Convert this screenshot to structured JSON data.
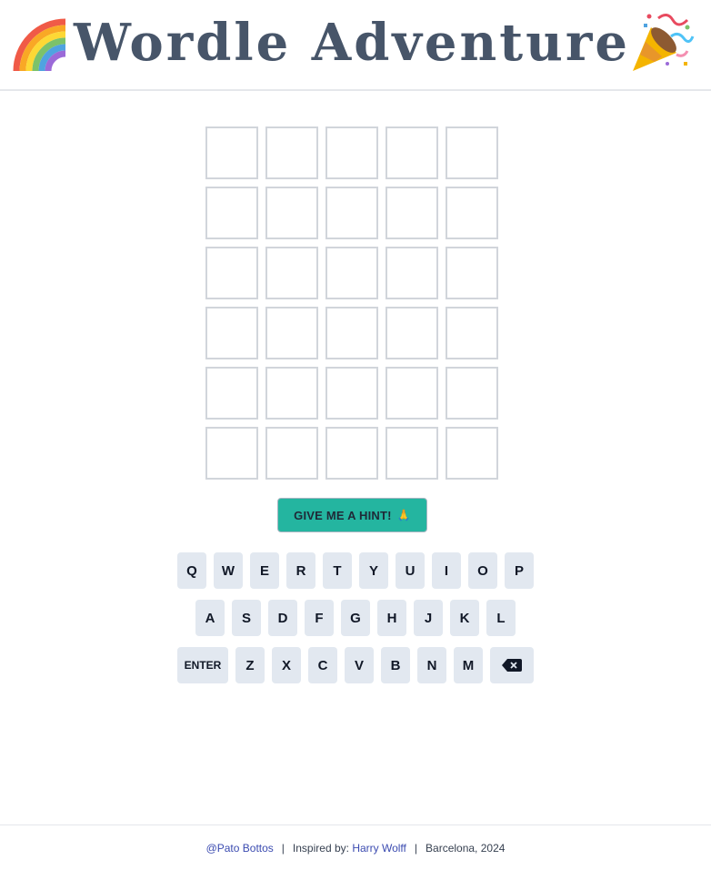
{
  "header": {
    "title": "Wordle Adventure",
    "left_icon": "rainbow-icon",
    "right_icon": "party-popper-icon"
  },
  "board": {
    "rows": 6,
    "cols": 5
  },
  "hint_button": {
    "label": "GIVE ME A HINT!",
    "emoji": "🙏"
  },
  "keyboard": {
    "row1": [
      "Q",
      "W",
      "E",
      "R",
      "T",
      "Y",
      "U",
      "I",
      "O",
      "P"
    ],
    "row2": [
      "A",
      "S",
      "D",
      "F",
      "G",
      "H",
      "J",
      "K",
      "L"
    ],
    "row3": [
      "ENTER",
      "Z",
      "X",
      "C",
      "V",
      "B",
      "N",
      "M"
    ],
    "backspace_icon": "backspace-icon"
  },
  "footer": {
    "author": "@Pato Bottos",
    "inspired_label": "Inspired by:",
    "inspired_name": "Harry Wolff",
    "location": "Barcelona, 2024",
    "separator": "|"
  },
  "colors": {
    "title": "#475569",
    "hint_button_bg": "#24b5a0",
    "key_bg": "#e2e8f0",
    "tile_border": "#d1d5db",
    "link": "#3b4bb0"
  }
}
